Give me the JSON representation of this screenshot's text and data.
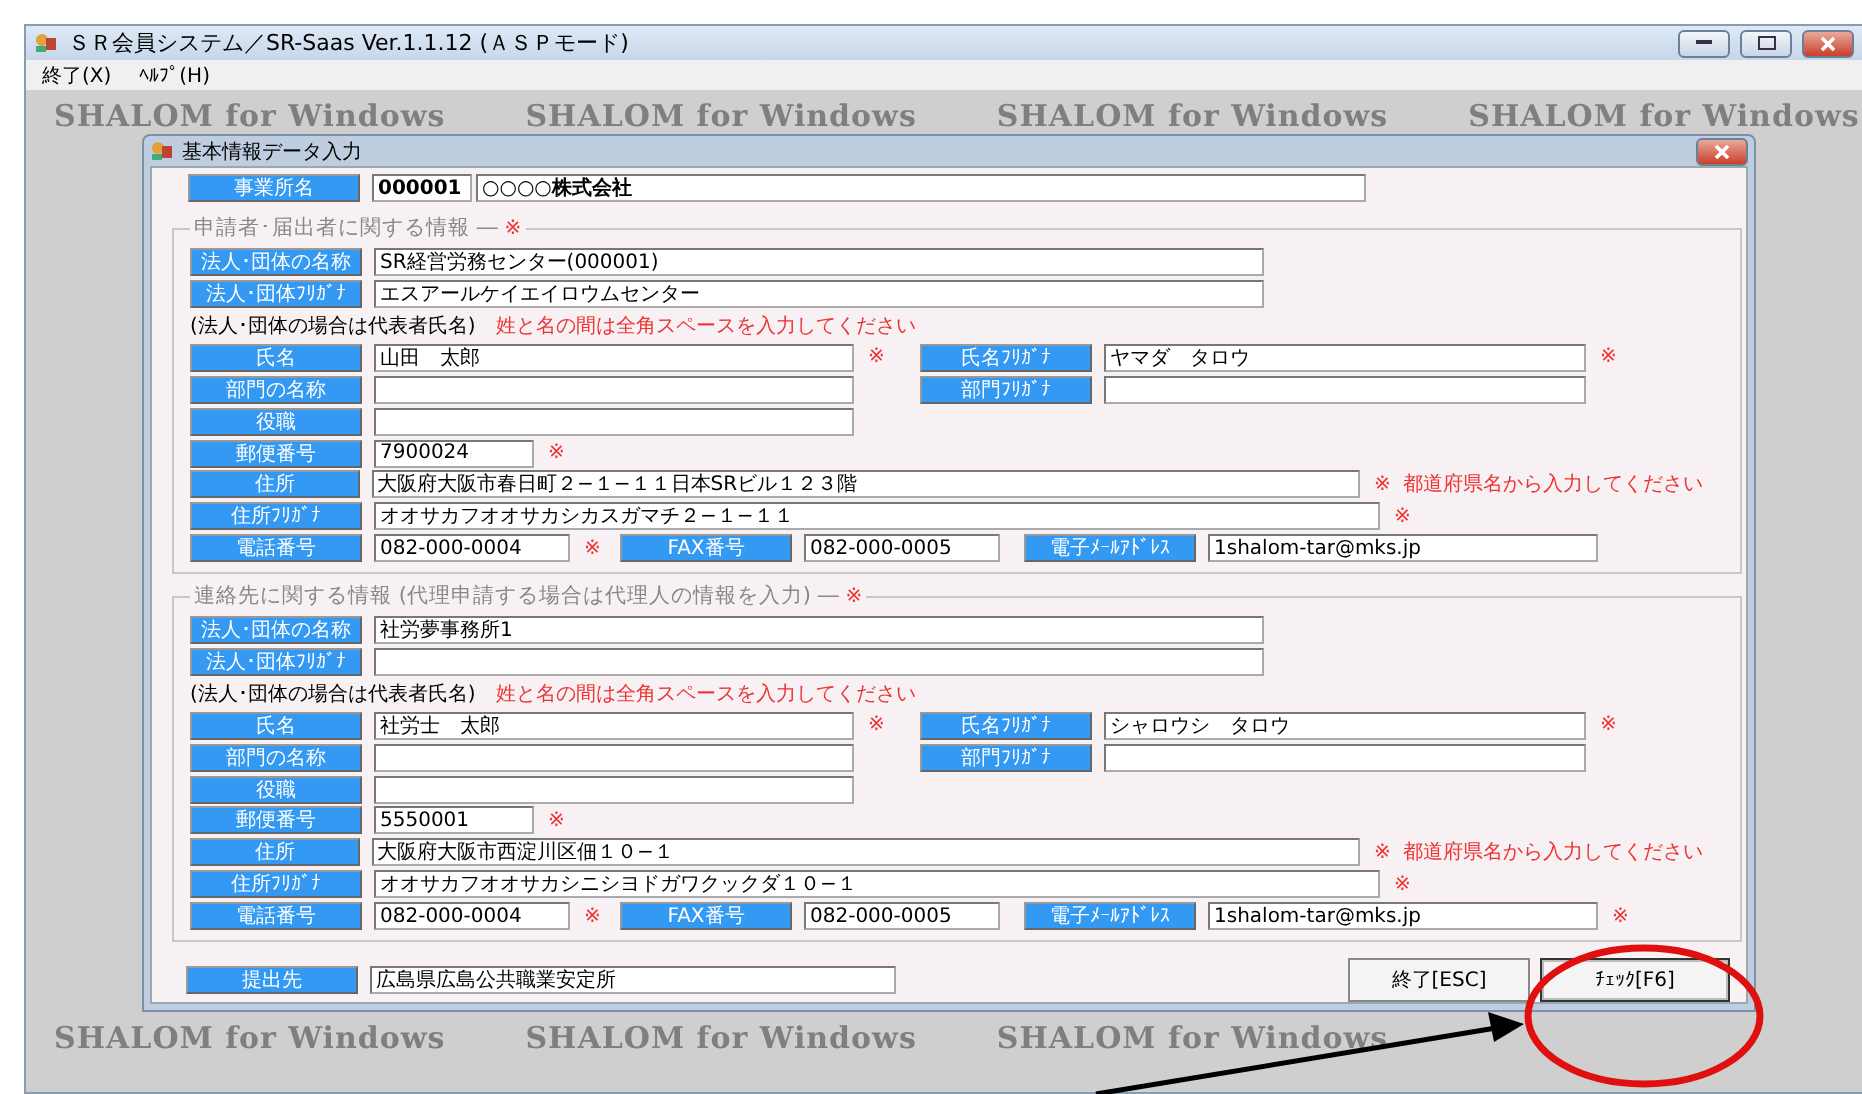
{
  "window": {
    "title": "ＳＲ会員システム／SR-Saas Ver.1.1.12 (ＡＳＰモード)"
  },
  "menu": [
    {
      "label": "終了(X)"
    },
    {
      "label": "ﾍﾙﾌﾟ(H)"
    }
  ],
  "wallpaper": [
    "SHALOM for Windows",
    "SHALOM for Windows",
    "SHALOM for Windows",
    "SHALOM for Windows",
    "SHALOM for Windows",
    "SHALOM for Windows",
    "SHALOM for Windows"
  ],
  "dialog": {
    "title": "基本情報データ入力",
    "office": {
      "label": "事業所名",
      "code": "000001",
      "name": "○○○○株式会社"
    },
    "sections": [
      {
        "legend": "申請者･届出者に関する情報 ―",
        "mark": "※",
        "corp_name": {
          "label": "法人･団体の名称",
          "value": "SR経営労務センター(000001)"
        },
        "corp_kana": {
          "label": "法人･団体ﾌﾘｶﾞﾅ",
          "value": "エスアールケイエイロウムセンター"
        },
        "note": {
          "text": "(法人･団体の場合は代表者氏名)",
          "warning": "姓と名の間は全角スペースを入力してください"
        },
        "name": {
          "label": "氏名",
          "value": "山田　太郎",
          "mark": "※"
        },
        "name_kana": {
          "label": "氏名ﾌﾘｶﾞﾅ",
          "value": "ヤマダ　タロウ",
          "mark": "※"
        },
        "dept": {
          "label": "部門の名称"
        },
        "dept_kana": {
          "label": "部門ﾌﾘｶﾞﾅ"
        },
        "position": {
          "label": "役職"
        },
        "postal": {
          "label": "郵便番号",
          "value": "7900024",
          "mark": "※"
        },
        "address": {
          "label": "住所",
          "value": "大阪府大阪市春日町２−１−１１日本SRビル１２３階",
          "mark": "※",
          "hint": "都道府県名から入力してください"
        },
        "address_kana": {
          "label": "住所ﾌﾘｶﾞﾅ",
          "value": "オオサカフオオサカシカスガマチ２−１−１１",
          "mark": "※"
        },
        "phone": {
          "label": "電話番号",
          "value": "082-000-0004",
          "mark": "※"
        },
        "fax": {
          "label": "FAX番号",
          "value": "082-000-0005"
        },
        "email": {
          "label": "電子ﾒｰﾙｱﾄﾞﾚｽ",
          "value": "1shalom-tar@mks.jp"
        }
      },
      {
        "legend": "連絡先に関する情報 (代理申請する場合は代理人の情報を入力) ―",
        "mark": "※",
        "corp_name": {
          "label": "法人･団体の名称",
          "value": "社労夢事務所1"
        },
        "corp_kana": {
          "label": "法人･団体ﾌﾘｶﾞﾅ"
        },
        "note": {
          "text": "(法人･団体の場合は代表者氏名)",
          "warning": "姓と名の間は全角スペースを入力してください"
        },
        "name": {
          "label": "氏名",
          "value": "社労士　太郎",
          "mark": "※"
        },
        "name_kana": {
          "label": "氏名ﾌﾘｶﾞﾅ",
          "value": "シャロウシ　タロウ",
          "mark": "※"
        },
        "dept": {
          "label": "部門の名称"
        },
        "dept_kana": {
          "label": "部門ﾌﾘｶﾞﾅ"
        },
        "position": {
          "label": "役職"
        },
        "postal": {
          "label": "郵便番号",
          "value": "5550001",
          "mark": "※"
        },
        "address": {
          "label": "住所",
          "value": "大阪府大阪市西淀川区佃１０−１",
          "mark": "※",
          "hint": "都道府県名から入力してください"
        },
        "address_kana": {
          "label": "住所ﾌﾘｶﾞﾅ",
          "value": "オオサカフオオサカシニシヨドガワクックダ１０−１",
          "mark": "※"
        },
        "phone": {
          "label": "電話番号",
          "value": "082-000-0004",
          "mark": "※"
        },
        "fax": {
          "label": "FAX番号",
          "value": "082-000-0005"
        },
        "email": {
          "label": "電子ﾒｰﾙｱﾄﾞﾚｽ",
          "value": "1shalom-tar@mks.jp",
          "mark": "※"
        }
      }
    ],
    "destination": {
      "label": "提出先",
      "value": "広島県広島公共職業安定所"
    },
    "buttons": [
      {
        "label": "終了[ESC]",
        "selected": false
      },
      {
        "label": "ﾁｪｯｸ[F6]",
        "selected": true
      }
    ]
  }
}
